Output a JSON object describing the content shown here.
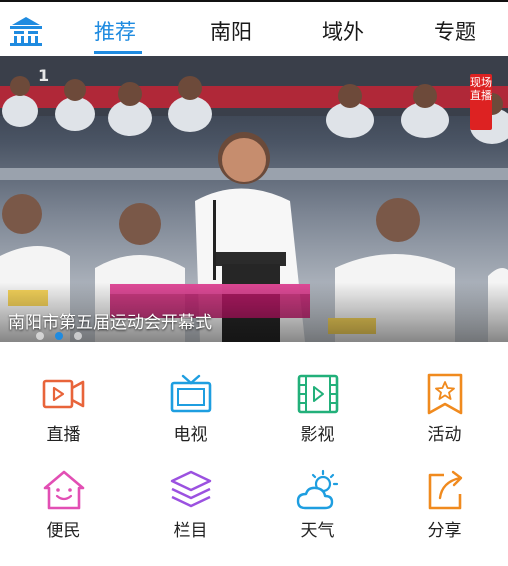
{
  "nav": {
    "tabs": [
      {
        "label": "推荐",
        "active": true
      },
      {
        "label": "南阳",
        "active": false
      },
      {
        "label": "域外",
        "active": false
      },
      {
        "label": "专题",
        "active": false
      }
    ],
    "accent": "#1f8be0"
  },
  "hero": {
    "caption": "南阳市第五届运动会开幕式",
    "channel_logo": "1",
    "live_badge": "现场直播",
    "slide_count": 3,
    "active_slide": 2
  },
  "grid": {
    "items": [
      {
        "label": "直播",
        "icon": "live-camera-icon",
        "color": "#e8643a"
      },
      {
        "label": "电视",
        "icon": "tv-icon",
        "color": "#1e9ee0"
      },
      {
        "label": "影视",
        "icon": "film-icon",
        "color": "#22b07a"
      },
      {
        "label": "活动",
        "icon": "activity-star-icon",
        "color": "#f08a1e"
      },
      {
        "label": "便民",
        "icon": "home-smile-icon",
        "color": "#e24fb4"
      },
      {
        "label": "栏目",
        "icon": "layers-icon",
        "color": "#9b51e0"
      },
      {
        "label": "天气",
        "icon": "weather-icon",
        "color": "#1e9ee0"
      },
      {
        "label": "分享",
        "icon": "share-icon",
        "color": "#f08a1e"
      }
    ]
  }
}
